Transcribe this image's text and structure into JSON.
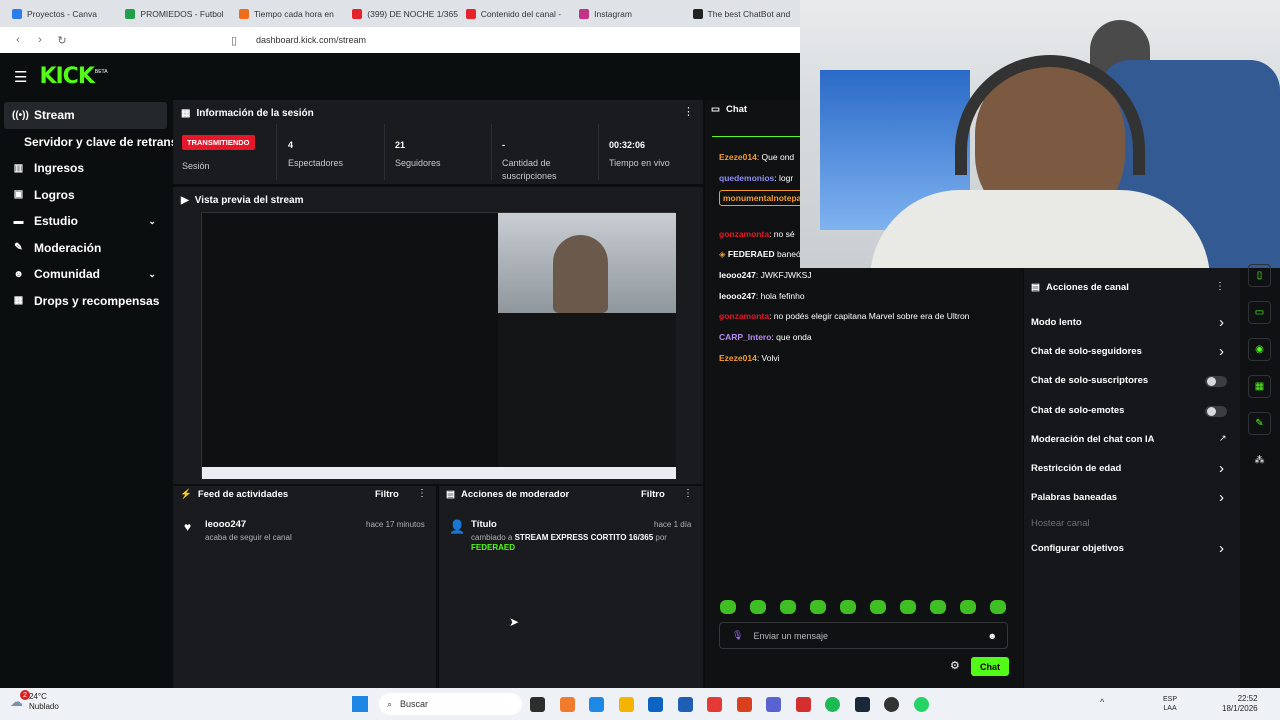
{
  "browser": {
    "tabs": [
      {
        "label": "Proyectos - Canva",
        "color": "#2b7de9"
      },
      {
        "label": "PROMIEDOS - Futbol",
        "color": "#1fa04b"
      },
      {
        "label": "Tiempo cada hora en",
        "color": "#ef6c1a"
      },
      {
        "label": "(399) DE NOCHE 1/365",
        "color": "#e4232b"
      },
      {
        "label": "Contenido del canal -",
        "color": "#e4232b"
      },
      {
        "label": "Instagram",
        "color": "#c13584"
      },
      {
        "label": "The best ChatBot and",
        "color": "#222222"
      }
    ],
    "url": "dashboard.kick.com/stream"
  },
  "brand": {
    "logo": "KICK",
    "beta": "BETA",
    "accent": "#53fc18"
  },
  "sidebar": [
    {
      "label": "Stream",
      "icon": "broadcast-icon",
      "glyph": "((•))"
    },
    {
      "label": "Servidor y clave de retransm",
      "icon": "",
      "glyph": ""
    },
    {
      "label": "Ingresos",
      "icon": "chart-icon",
      "glyph": "▥"
    },
    {
      "label": "Logros",
      "icon": "trophy-icon",
      "glyph": "▣"
    },
    {
      "label": "Estudio",
      "icon": "video-icon",
      "glyph": "▬"
    },
    {
      "label": "Moderación",
      "icon": "wrench-icon",
      "glyph": "✎"
    },
    {
      "label": "Comunidad",
      "icon": "people-icon",
      "glyph": "☻"
    },
    {
      "label": "Drops y recompensas",
      "icon": "gift-icon",
      "glyph": "▦"
    }
  ],
  "session": {
    "title": "Información de la sesión",
    "badge": "TRANSMITIENDO",
    "badge_caption": "Sesión",
    "stats": [
      {
        "value": "4",
        "label": "Espectadores"
      },
      {
        "value": "21",
        "label": "Seguidores"
      },
      {
        "value": "-",
        "label": "Cantidad de suscripciones"
      },
      {
        "value": "00:32:06",
        "label": "Tiempo en vivo"
      }
    ]
  },
  "preview": {
    "title": "Vista previa del stream"
  },
  "activity": {
    "title": "Feed de actividades",
    "filter": "Filtro",
    "item": {
      "user": "leooo247",
      "desc": "acaba de seguir el canal",
      "time": "hace 17 minutos"
    }
  },
  "modactions": {
    "title": "Acciones de moderador",
    "filter": "Filtro",
    "item": {
      "label": "Título",
      "time": "hace 1 día",
      "desc_prefix": "cambiado a",
      "desc_bold": "STREAM EXPRESS CORTITO 16/365",
      "desc_by": "por",
      "actor": "FEDERAED"
    }
  },
  "chat": {
    "title": "Chat",
    "messages": [
      {
        "user": "Ezeze014",
        "color": "#f59b2b",
        "text": "Que ond"
      },
      {
        "user": "quedemonios",
        "color": "#8d8df6",
        "text": "logr"
      },
      {
        "user": "monumentalnotepa",
        "color": "#f59b2b",
        "text": "nez hna co"
      },
      {
        "user": "gonzamonta",
        "color": "#e5182a",
        "text": "no sé"
      },
      {
        "user": "FEDERAED",
        "color": "#ffffff",
        "text": "baneó"
      },
      {
        "user": "leooo247",
        "color": "#ffffff",
        "text": "JWKFJWKSJ"
      },
      {
        "user": "leooo247",
        "color": "#ffffff",
        "text": "hola fefinho"
      },
      {
        "user": "gonzamonta",
        "color": "#e5182a",
        "text": "no podés elegir capitana Marvel sobre era de Ultron"
      },
      {
        "user": "CARP_Intero",
        "color": "#b88bf6",
        "text": "que onda"
      },
      {
        "user": "Ezeze014",
        "color": "#f59b2b",
        "text": "Volvi"
      }
    ],
    "placeholder": "Enviar un mensaje",
    "send": "Chat"
  },
  "channel_actions": {
    "title": "Acciones de canal",
    "items": [
      {
        "label": "Modo lento",
        "control": "arrow"
      },
      {
        "label": "Chat de solo-seguidores",
        "control": "arrow"
      },
      {
        "label": "Chat de solo-suscriptores",
        "control": "toggle"
      },
      {
        "label": "Chat de solo-emotes",
        "control": "toggle"
      },
      {
        "label": "Moderación del chat con IA",
        "control": "external"
      },
      {
        "label": "Restricción de edad",
        "control": "arrow"
      },
      {
        "label": "Palabras baneadas",
        "control": "arrow"
      },
      {
        "label": "Hostear canal",
        "control": "disabled"
      },
      {
        "label": "Configurar objetivos",
        "control": "arrow"
      }
    ]
  },
  "taskbar": {
    "weather_temp": "24°C",
    "weather_desc": "Nublado",
    "badge": "2",
    "search": "Buscar",
    "lang1": "ESP",
    "lang2": "LAA",
    "time": "22:52",
    "date": "18/1/2026"
  }
}
